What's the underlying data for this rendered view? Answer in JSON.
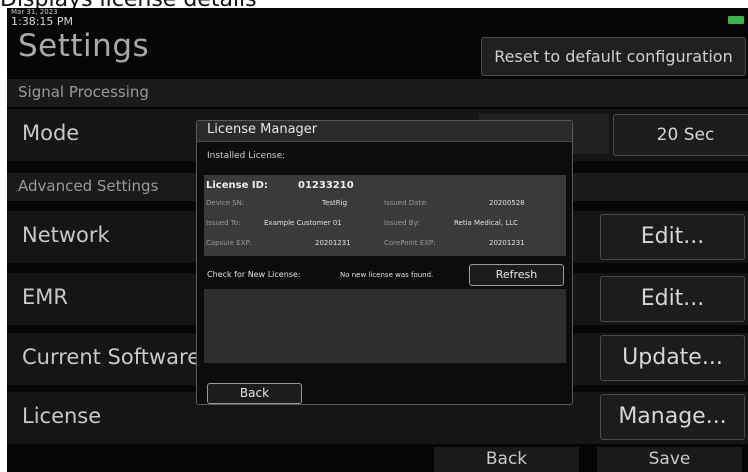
{
  "caption": "Displays license details",
  "status": {
    "date": "Mar 31, 2023",
    "time": "1:38:15 PM"
  },
  "header": {
    "title": "Settings",
    "reset_label": "Reset to default configuration"
  },
  "sections": {
    "signal_processing": "Signal Processing",
    "advanced": "Advanced Settings"
  },
  "rows": {
    "mode": {
      "label": "Mode",
      "button": "20 Sec"
    },
    "network": {
      "label": "Network",
      "button": "Edit..."
    },
    "emr": {
      "label": "EMR",
      "button": "Edit..."
    },
    "software": {
      "label": "Current Software",
      "button": "Update..."
    },
    "license": {
      "label": "License",
      "button": "Manage..."
    }
  },
  "footer": {
    "back": "Back",
    "save": "Save"
  },
  "dialog": {
    "title": "License Manager",
    "installed_label": "Installed License:",
    "license_id_label": "License ID:",
    "license_id": "01233210",
    "fields": {
      "device_sn_label": "Device SN:",
      "device_sn": "TestRig",
      "issued_date_label": "Issued Date:",
      "issued_date": "20200528",
      "issued_to_label": "Issued To:",
      "issued_to": "Example Customer 01",
      "issued_by_label": "Issued By:",
      "issued_by": "Retia Medical, LLC",
      "capsule_exp_label": "Capsule EXP:",
      "capsule_exp": "20201231",
      "corepoint_exp_label": "CorePoint EXP:",
      "corepoint_exp": "20201231"
    },
    "check_label": "Check for New License:",
    "check_status": "No new license was found.",
    "refresh_label": "Refresh",
    "back_label": "Back"
  },
  "colors": {
    "battery": "#3bb54a",
    "background": "#060606"
  }
}
